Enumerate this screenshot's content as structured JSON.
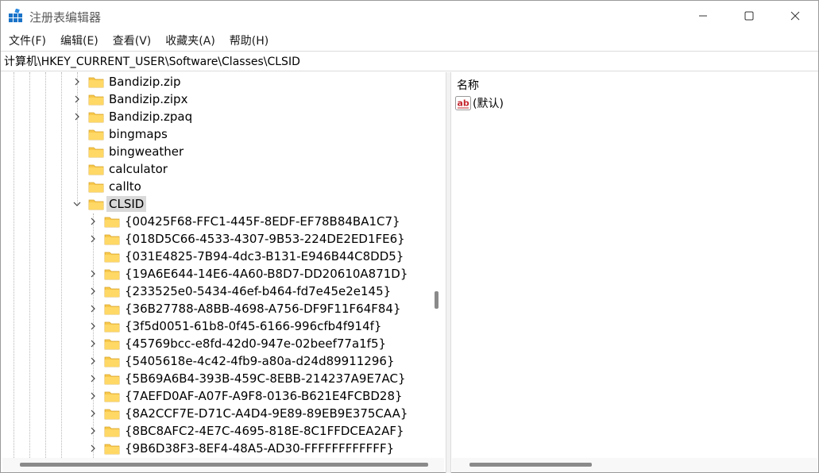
{
  "window": {
    "title": "注册表编辑器"
  },
  "menu": [
    "文件(F)",
    "编辑(E)",
    "查看(V)",
    "收藏夹(A)",
    "帮助(H)"
  ],
  "address": "计算机\\HKEY_CURRENT_USER\\Software\\Classes\\CLSID",
  "tree": {
    "level2": [
      {
        "label": "Bandizip.zip",
        "expandable": true
      },
      {
        "label": "Bandizip.zipx",
        "expandable": true
      },
      {
        "label": "Bandizip.zpaq",
        "expandable": true
      },
      {
        "label": "bingmaps",
        "expandable": false
      },
      {
        "label": "bingweather",
        "expandable": false
      },
      {
        "label": "calculator",
        "expandable": false
      },
      {
        "label": "callto",
        "expandable": false
      },
      {
        "label": "CLSID",
        "expandable": true,
        "expanded": true,
        "selected": true
      }
    ],
    "clsid_children": [
      {
        "label": "{00425F68-FFC1-445F-8EDF-EF78B84BA1C7}",
        "expandable": true
      },
      {
        "label": "{018D5C66-4533-4307-9B53-224DE2ED1FE6}",
        "expandable": true
      },
      {
        "label": "{031E4825-7B94-4dc3-B131-E946B44C8DD5}",
        "expandable": false
      },
      {
        "label": "{19A6E644-14E6-4A60-B8D7-DD20610A871D}",
        "expandable": true
      },
      {
        "label": "{233525e0-5434-46ef-b464-fd7e45e2e145}",
        "expandable": true
      },
      {
        "label": "{36B27788-A8BB-4698-A756-DF9F11F64F84}",
        "expandable": true
      },
      {
        "label": "{3f5d0051-61b8-0f45-6166-996cfb4f914f}",
        "expandable": true
      },
      {
        "label": "{45769bcc-e8fd-42d0-947e-02beef77a1f5}",
        "expandable": true
      },
      {
        "label": "{5405618e-4c42-4fb9-a80a-d24d89911296}",
        "expandable": true
      },
      {
        "label": "{5B69A6B4-393B-459C-8EBB-214237A9E7AC}",
        "expandable": true
      },
      {
        "label": "{7AEFD0AF-A07F-A9F8-0136-B621E4FCBD28}",
        "expandable": true
      },
      {
        "label": "{8A2CCF7E-D71C-A4D4-9E89-89EB9E375CAA}",
        "expandable": true
      },
      {
        "label": "{8BC8AFC2-4E7C-4695-818E-8C1FFDCEA2AF}",
        "expandable": true
      },
      {
        "label": "{9B6D38F3-8EF4-48A5-AD30-FFFFFFFFFFFF}",
        "expandable": true
      }
    ]
  },
  "values_pane": {
    "column_name": "名称",
    "rows": [
      {
        "icon": "string-value-icon",
        "name": "(默认)"
      }
    ]
  },
  "colors": {
    "folder": "#F8C84A",
    "selected_bg": "#D9D9D9"
  }
}
